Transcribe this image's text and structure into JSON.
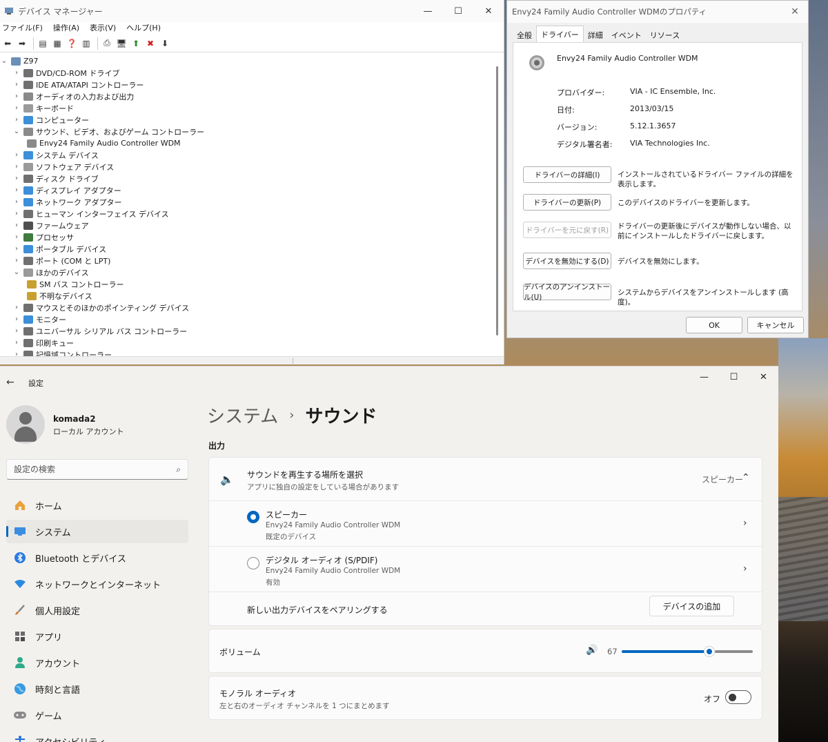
{
  "device_manager": {
    "title": "デバイス マネージャー",
    "menu": [
      "ファイル(F)",
      "操作(A)",
      "表示(V)",
      "ヘルプ(H)"
    ],
    "root": "Z97",
    "tree": [
      {
        "label": "DVD/CD-ROM ドライブ",
        "expanded": false,
        "icon_color": "#707070"
      },
      {
        "label": "IDE ATA/ATAPI コントローラー",
        "expanded": false,
        "icon_color": "#707070"
      },
      {
        "label": "オーディオの入力および出力",
        "expanded": false,
        "icon_color": "#8a8a8a"
      },
      {
        "label": "キーボード",
        "expanded": false,
        "icon_color": "#9a9a9a"
      },
      {
        "label": "コンピューター",
        "expanded": false,
        "icon_color": "#3c8fd8"
      },
      {
        "label": "サウンド、ビデオ、およびゲーム コントローラー",
        "expanded": true,
        "icon_color": "#8a8a8a"
      },
      {
        "label": "Envy24 Family Audio Controller WDM",
        "child": true,
        "icon_color": "#8a8a8a"
      },
      {
        "label": "システム デバイス",
        "expanded": false,
        "icon_color": "#3c8fd8"
      },
      {
        "label": "ソフトウェア デバイス",
        "expanded": false,
        "icon_color": "#9a9a9a"
      },
      {
        "label": "ディスク ドライブ",
        "expanded": false,
        "icon_color": "#707070"
      },
      {
        "label": "ディスプレイ アダプター",
        "expanded": false,
        "icon_color": "#3c8fd8"
      },
      {
        "label": "ネットワーク アダプター",
        "expanded": false,
        "icon_color": "#3c8fd8"
      },
      {
        "label": "ヒューマン インターフェイス デバイス",
        "expanded": false,
        "icon_color": "#707070"
      },
      {
        "label": "ファームウェア",
        "expanded": false,
        "icon_color": "#505050"
      },
      {
        "label": "プロセッサ",
        "expanded": false,
        "icon_color": "#3f7a3f"
      },
      {
        "label": "ポータブル デバイス",
        "expanded": false,
        "icon_color": "#3c8fd8"
      },
      {
        "label": "ポート (COM と LPT)",
        "expanded": false,
        "icon_color": "#707070"
      },
      {
        "label": "ほかのデバイス",
        "expanded": true,
        "icon_color": "#9a9a9a"
      },
      {
        "label": "SM バス コントローラー",
        "child": true,
        "icon_color": "#c8a030"
      },
      {
        "label": "不明なデバイス",
        "child": true,
        "icon_color": "#c8a030"
      },
      {
        "label": "マウスとそのほかのポインティング デバイス",
        "expanded": false,
        "icon_color": "#707070"
      },
      {
        "label": "モニター",
        "expanded": false,
        "icon_color": "#3c8fd8"
      },
      {
        "label": "ユニバーサル シリアル バス コントローラー",
        "expanded": false,
        "icon_color": "#707070"
      },
      {
        "label": "印刷キュー",
        "expanded": false,
        "icon_color": "#707070"
      },
      {
        "label": "記憶域コントローラー",
        "expanded": false,
        "icon_color": "#707070"
      }
    ]
  },
  "properties": {
    "title": "Envy24 Family Audio Controller WDMのプロパティ",
    "tabs": [
      "全般",
      "ドライバー",
      "詳細",
      "イベント",
      "リソース"
    ],
    "device_name": "Envy24 Family Audio Controller WDM",
    "info": [
      {
        "key": "プロバイダー:",
        "value": "VIA - IC Ensemble, Inc."
      },
      {
        "key": "日付:",
        "value": "2013/03/15"
      },
      {
        "key": "バージョン:",
        "value": "5.12.1.3657"
      },
      {
        "key": "デジタル署名者:",
        "value": "VIA Technologies Inc."
      }
    ],
    "buttons": [
      {
        "label": "ドライバーの詳細(I)",
        "desc": "インストールされているドライバー ファイルの詳細を表示します。",
        "enabled": true
      },
      {
        "label": "ドライバーの更新(P)",
        "desc": "このデバイスのドライバーを更新します。",
        "enabled": true
      },
      {
        "label": "ドライバーを元に戻す(R)",
        "desc": "ドライバーの更新後にデバイスが動作しない場合、以前にインストールしたドライバーに戻します。",
        "enabled": false
      },
      {
        "label": "デバイスを無効にする(D)",
        "desc": "デバイスを無効にします。",
        "enabled": true
      },
      {
        "label": "デバイスのアンインストール(U)",
        "desc": "システムからデバイスをアンインストールします (高度)。",
        "enabled": true
      }
    ],
    "ok_label": "OK",
    "cancel_label": "キャンセル"
  },
  "settings": {
    "app_title": "設定",
    "user": {
      "name": "komada2",
      "type": "ローカル アカウント"
    },
    "search_placeholder": "設定の検索",
    "nav": [
      {
        "label": "ホーム",
        "icon": "home-icon"
      },
      {
        "label": "システム",
        "icon": "system-icon",
        "active": true
      },
      {
        "label": "Bluetooth とデバイス",
        "icon": "bluetooth-icon"
      },
      {
        "label": "ネットワークとインターネット",
        "icon": "network-icon"
      },
      {
        "label": "個人用設定",
        "icon": "brush-icon"
      },
      {
        "label": "アプリ",
        "icon": "apps-icon"
      },
      {
        "label": "アカウント",
        "icon": "account-icon"
      },
      {
        "label": "時刻と言語",
        "icon": "globe-icon"
      },
      {
        "label": "ゲーム",
        "icon": "gamepad-icon"
      },
      {
        "label": "アクセシビリティ",
        "icon": "accessibility-icon"
      }
    ],
    "breadcrumb": {
      "parent": "システム",
      "current": "サウンド"
    },
    "output_label": "出力",
    "output_select": {
      "title": "サウンドを再生する場所を選択",
      "sub": "アプリに独自の設定をしている場合があります",
      "selected": "スピーカー"
    },
    "devices": [
      {
        "name": "スピーカー",
        "sub1": "Envy24 Family Audio Controller WDM",
        "sub2": "既定のデバイス",
        "selected": true
      },
      {
        "name": "デジタル オーディオ (S/PDIF)",
        "sub1": "Envy24 Family Audio Controller WDM",
        "sub2": "有効",
        "selected": false
      }
    ],
    "pair": {
      "label": "新しい出力デバイスをペアリングする",
      "button": "デバイスの追加"
    },
    "volume": {
      "label": "ボリューム",
      "value": 67
    },
    "mono": {
      "title": "モノラル オーディオ",
      "sub": "左と右のオーディオ チャンネルを 1 つにまとめます",
      "state": "オフ"
    },
    "accent": "#0067c0"
  }
}
